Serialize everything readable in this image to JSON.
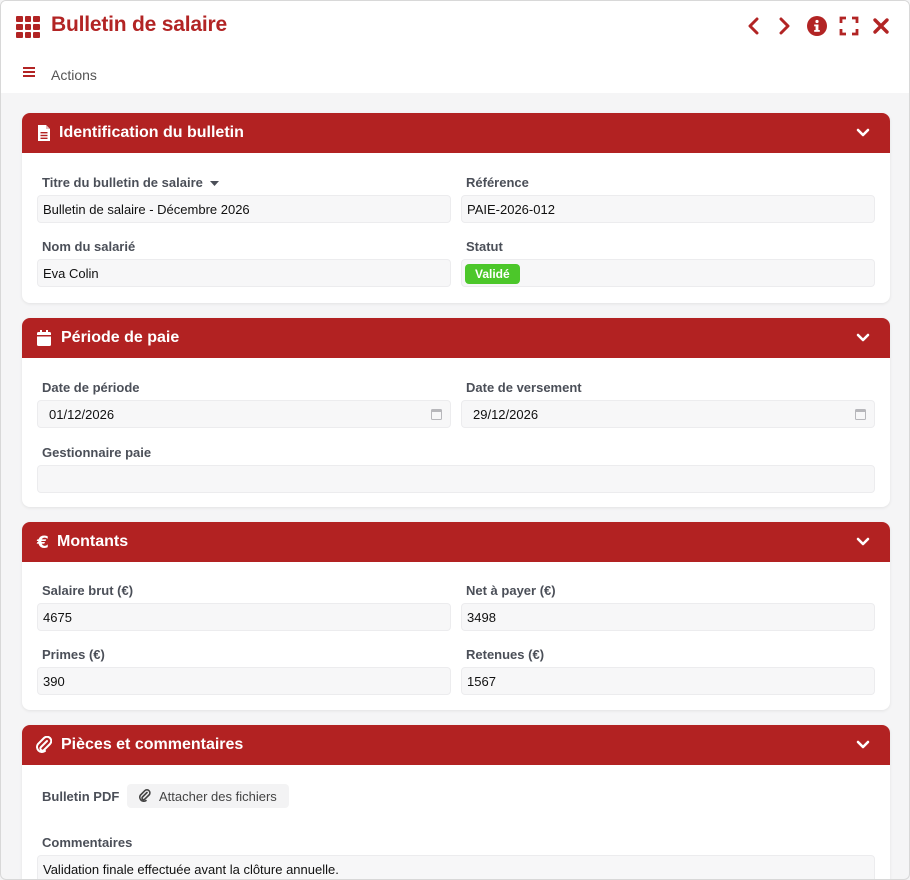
{
  "window": {
    "title": "Bulletin de salaire",
    "actions_label": "Actions"
  },
  "colors": {
    "accent": "#b22424",
    "header_bg": "#b22222",
    "badge_success": "#4cc72a"
  },
  "sections": {
    "identification": {
      "title": "Identification du bulletin",
      "icon": "document-icon",
      "fields": {
        "titre_label": "Titre du bulletin de salaire",
        "titre_value": "Bulletin de salaire - Décembre 2026",
        "reference_label": "Référence",
        "reference_value": "PAIE-2026-012",
        "salarie_label": "Nom du salarié",
        "salarie_value": "Eva Colin",
        "statut_label": "Statut",
        "statut_value": "Validé"
      }
    },
    "periode": {
      "title": "Période de paie",
      "icon": "calendar-icon",
      "fields": {
        "date_periode_label": "Date de période",
        "date_periode_value": "01/12/2026",
        "date_versement_label": "Date de versement",
        "date_versement_value": "29/12/2026",
        "gestionnaire_label": "Gestionnaire paie",
        "gestionnaire_value": ""
      }
    },
    "montants": {
      "title": "Montants",
      "icon": "euro-icon",
      "fields": {
        "brut_label": "Salaire brut (€)",
        "brut_value": "4675",
        "net_label": "Net à payer (€)",
        "net_value": "3498",
        "primes_label": "Primes (€)",
        "primes_value": "390",
        "retenues_label": "Retenues (€)",
        "retenues_value": "1567"
      }
    },
    "pieces": {
      "title": "Pièces et commentaires",
      "icon": "paperclip-icon",
      "fields": {
        "pdf_label": "Bulletin PDF",
        "attach_label": "Attacher des fichiers",
        "commentaires_label": "Commentaires",
        "commentaires_value": "Validation finale effectuée avant la clôture annuelle."
      }
    }
  }
}
